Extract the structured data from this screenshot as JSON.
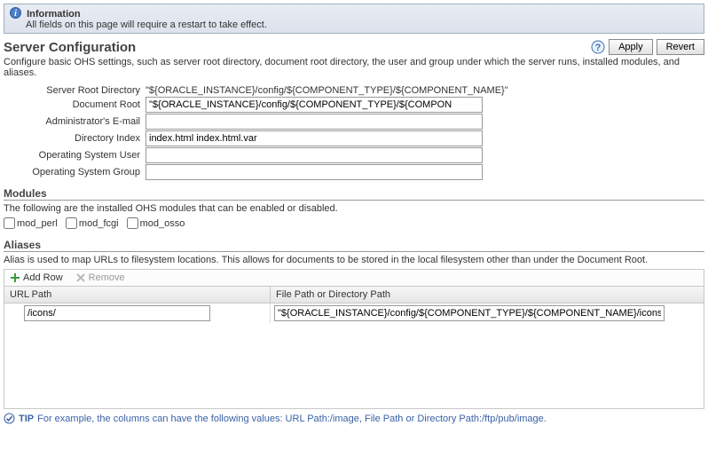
{
  "info": {
    "title": "Information",
    "text": "All fields on this page will require a restart to take effect."
  },
  "header": {
    "title": "Server Configuration",
    "apply": "Apply",
    "revert": "Revert"
  },
  "description": "Configure basic OHS settings, such as server root directory, document root directory, the user and group under which the server runs, installed modules, and aliases.",
  "form": {
    "serverRootLabel": "Server Root Directory",
    "serverRootValue": "\"${ORACLE_INSTANCE}/config/${COMPONENT_TYPE}/${COMPONENT_NAME}\"",
    "docRootLabel": "Document Root",
    "docRootValue": "\"${ORACLE_INSTANCE}/config/${COMPONENT_TYPE}/${COMPON",
    "adminEmailLabel": "Administrator's E-mail",
    "adminEmailValue": "",
    "dirIndexLabel": "Directory Index",
    "dirIndexValue": "index.html index.html.var",
    "osUserLabel": "Operating System User",
    "osUserValue": "",
    "osGroupLabel": "Operating System Group",
    "osGroupValue": ""
  },
  "modules": {
    "title": "Modules",
    "desc": "The following are the installed OHS modules that can be enabled or disabled.",
    "items": [
      "mod_perl",
      "mod_fcgi",
      "mod_osso"
    ]
  },
  "aliases": {
    "title": "Aliases",
    "desc": "Alias is used to map URLs to filesystem locations. This allows for documents to be stored in the local filesystem other than under the Document Root.",
    "addRow": "Add Row",
    "remove": "Remove",
    "colUrl": "URL Path",
    "colFile": "File Path or Directory Path",
    "rows": [
      {
        "url": "/icons/",
        "file": "\"${ORACLE_INSTANCE}/config/${COMPONENT_TYPE}/${COMPONENT_NAME}/icons/\""
      }
    ]
  },
  "tip": {
    "label": "TIP",
    "text": "For example, the columns can have the following values: URL Path:/image, File Path or Directory Path:/ftp/pub/image."
  }
}
